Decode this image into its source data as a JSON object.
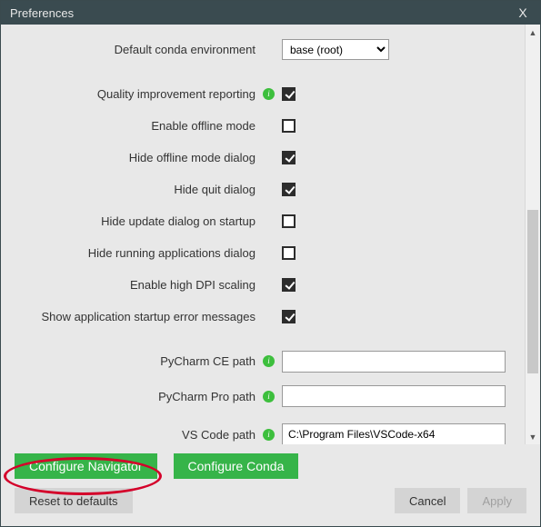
{
  "window": {
    "title": "Preferences",
    "close_glyph": "X"
  },
  "scroll": {
    "up_glyph": "▲",
    "down_glyph": "▼"
  },
  "fields": {
    "default_env": {
      "label": "Default conda environment",
      "value": "base (root)"
    },
    "quality_reporting": {
      "label": "Quality improvement reporting",
      "checked": true
    },
    "offline_mode": {
      "label": "Enable offline mode",
      "checked": false
    },
    "hide_offline_dialog": {
      "label": "Hide offline mode dialog",
      "checked": true
    },
    "hide_quit_dialog": {
      "label": "Hide quit dialog",
      "checked": true
    },
    "hide_update_dialog": {
      "label": "Hide update dialog on startup",
      "checked": false
    },
    "hide_running_dialog": {
      "label": "Hide running applications dialog",
      "checked": false
    },
    "high_dpi": {
      "label": "Enable high DPI scaling",
      "checked": true
    },
    "startup_errors": {
      "label": "Show application startup error messages",
      "checked": true
    },
    "pycharm_ce": {
      "label": "PyCharm CE path",
      "value": ""
    },
    "pycharm_pro": {
      "label": "PyCharm Pro path",
      "value": ""
    },
    "vscode": {
      "label": "VS Code path",
      "value": "C:\\Program Files\\VSCode-x64"
    }
  },
  "buttons": {
    "configure_navigator": "Configure Navigator",
    "configure_conda": "Configure Conda",
    "reset": "Reset to defaults",
    "cancel": "Cancel",
    "apply": "Apply"
  }
}
